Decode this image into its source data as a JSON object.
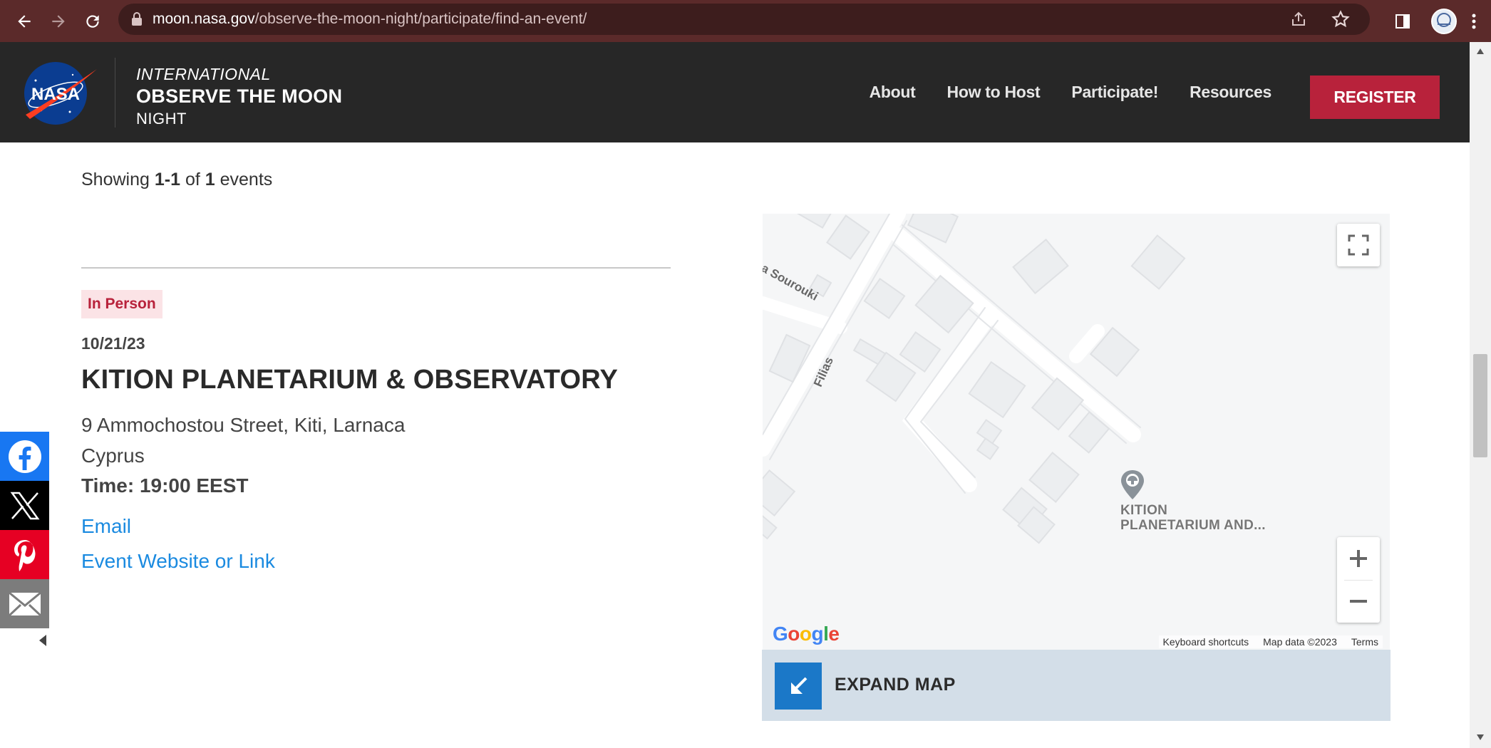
{
  "browser": {
    "url_domain": "moon.nasa.gov",
    "url_path": "/observe-the-moon-night/participate/find-an-event/"
  },
  "header": {
    "logo_text": "NASA",
    "brand_line1": "INTERNATIONAL",
    "brand_line2": "OBSERVE THE MOON",
    "brand_line3": "NIGHT",
    "nav": [
      "About",
      "How to Host",
      "Participate!",
      "Resources"
    ],
    "register_label": "REGISTER"
  },
  "results": {
    "showing_prefix": "Showing",
    "range": "1-1",
    "of_label": "of",
    "total": "1",
    "suffix": "events"
  },
  "event": {
    "badge": "In Person",
    "date": "10/21/23",
    "title": "KITION PLANETARIUM & OBSERVATORY",
    "address_line1": "9 Ammochostou Street, Kiti, Larnaca",
    "address_line2": "Cyprus",
    "time": "Time: 19:00 EEST",
    "email_label": "Email",
    "website_label": "Event Website or Link"
  },
  "share": {
    "icons": [
      "facebook-icon",
      "x-icon",
      "pinterest-icon",
      "email-icon"
    ]
  },
  "map": {
    "street1": "ea Sourouki",
    "street2": "Filias",
    "marker_label_line1": "KITION",
    "marker_label_line2": "PLANETARIUM AND...",
    "google_logo": "Google",
    "keyboard_shortcuts": "Keyboard shortcuts",
    "map_data": "Map data ©2023",
    "terms": "Terms",
    "expand_label": "EXPAND MAP"
  },
  "colors": {
    "chrome": "#5b2a2a",
    "header_bg": "#272727",
    "register_bg": "#b8223b",
    "link": "#1a8ae0",
    "badge_bg": "#fbe3e6",
    "expand_bg": "#d3dee8",
    "expand_icon_bg": "#1b78c8"
  }
}
